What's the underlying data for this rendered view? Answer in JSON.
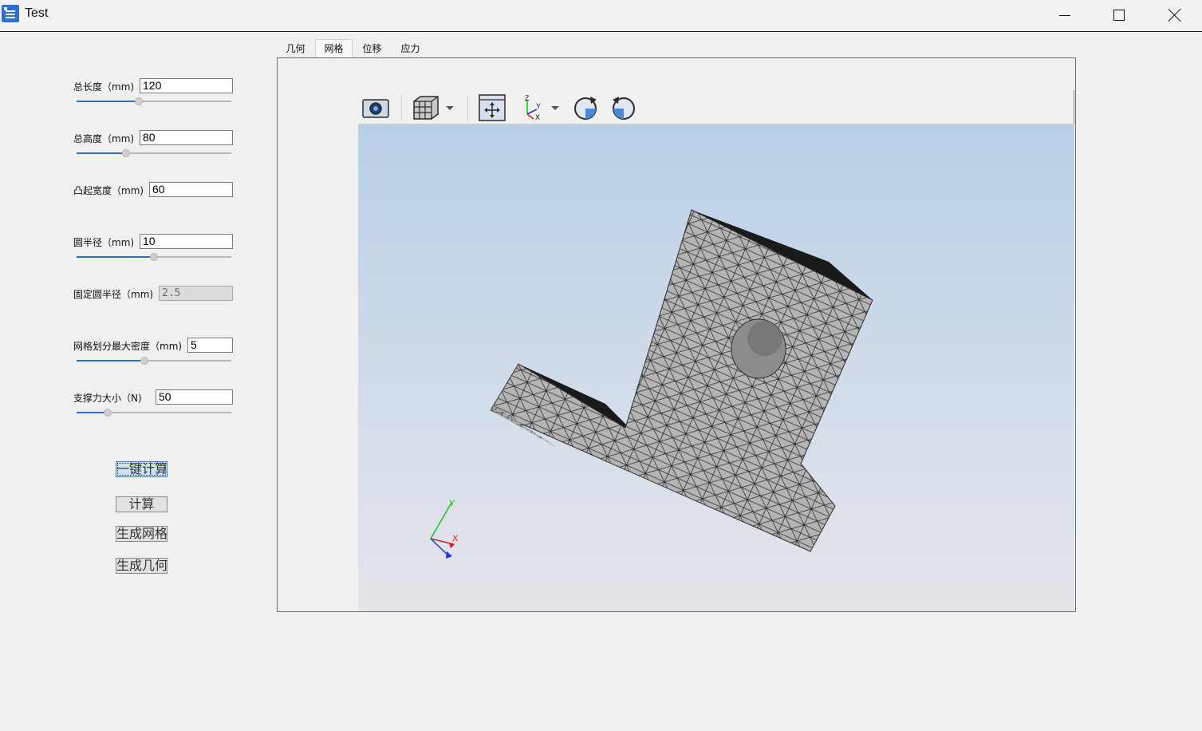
{
  "window": {
    "title": "Test"
  },
  "params": [
    {
      "label": "总长度（mm)",
      "value": "120",
      "slider": 0.4
    },
    {
      "label": "总高度（mm)",
      "value": "80",
      "slider": 0.32
    },
    {
      "label": "凸起宽度（mm)",
      "value": "60"
    },
    {
      "label": "圆半径（mm)",
      "value": "10",
      "slider": 0.5
    },
    {
      "label": "固定圆半径（mm)",
      "value": "2.5",
      "disabled": true
    },
    {
      "label": "网格划分最大密度（mm)",
      "value": "5",
      "slider": 0.44
    },
    {
      "label": "支撑力大小（N)",
      "value": "50",
      "slider": 0.2
    }
  ],
  "buttons": {
    "one_click": "一键计算",
    "compute": "计算",
    "gen_mesh": "生成网格",
    "gen_geometry": "生成几何"
  },
  "tabs": [
    {
      "label": "几何",
      "active": false
    },
    {
      "label": "网格",
      "active": true
    },
    {
      "label": "位移",
      "active": false
    },
    {
      "label": "应力",
      "active": false
    }
  ],
  "toolbar": {
    "icons": [
      "camera-icon",
      "cube-view-icon",
      "fit-view-icon",
      "axes-icon",
      "rotate-cw-icon",
      "rotate-ccw-icon"
    ]
  },
  "axes_triad": {
    "x": "X",
    "y": "Y",
    "z": "Z"
  },
  "colors": {
    "accent": "#2d6fd0",
    "mesh_fill": "#b4b4b4",
    "mesh_line": "#2a2a2a",
    "bg_top": "#b9cfe6",
    "bg_bottom": "#e4e5ea"
  }
}
